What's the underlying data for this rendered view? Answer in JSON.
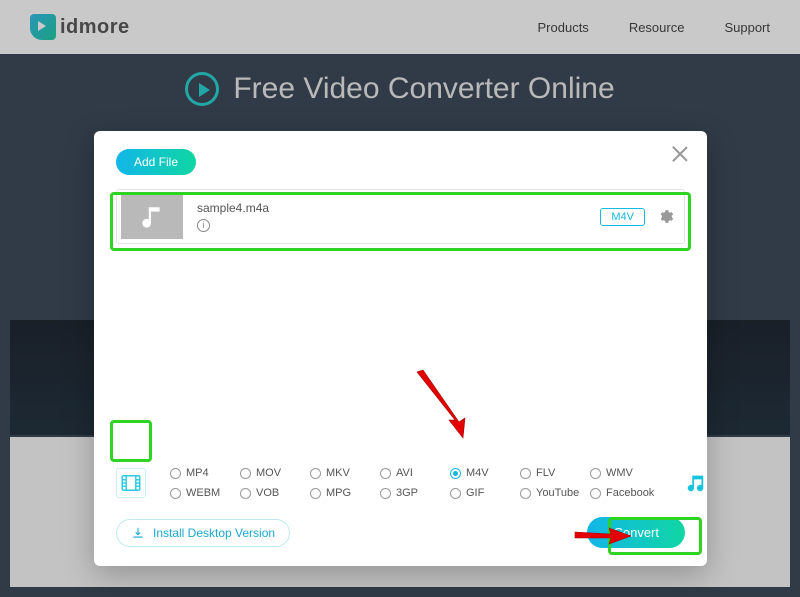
{
  "brand": {
    "name": "idmore"
  },
  "nav": {
    "products": "Products",
    "resource": "Resource",
    "support": "Support"
  },
  "hero": {
    "title": "Free Video Converter Online"
  },
  "modal": {
    "add_file": "Add File",
    "file": {
      "name": "sample4.m4a",
      "target_format": "M4V"
    },
    "install": "Install Desktop Version",
    "convert": "Convert"
  },
  "formats": {
    "row1": [
      "MP4",
      "MOV",
      "MKV",
      "AVI",
      "M4V",
      "FLV",
      "WMV"
    ],
    "row2": [
      "WEBM",
      "VOB",
      "MPG",
      "3GP",
      "GIF",
      "YouTube",
      "Facebook"
    ],
    "selected": "M4V"
  }
}
